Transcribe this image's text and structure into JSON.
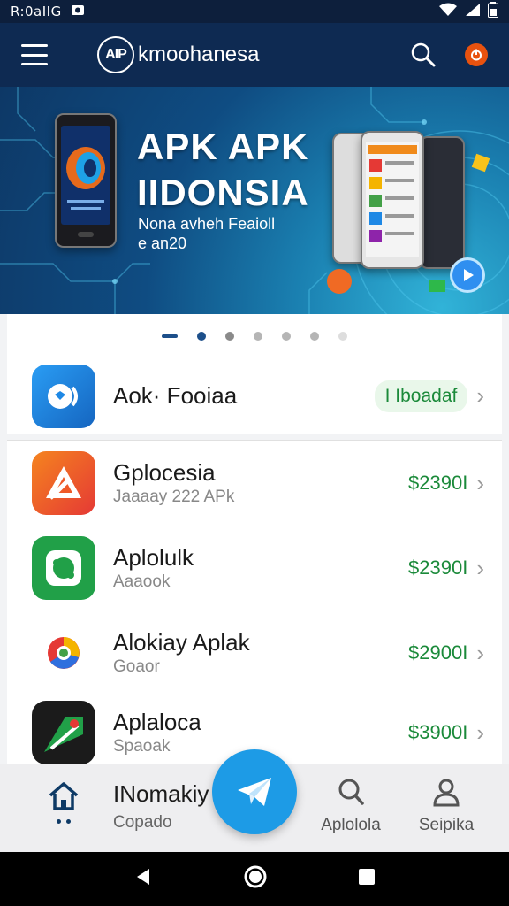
{
  "status_bar": {
    "time": "R:0aIIG"
  },
  "app_bar": {
    "logo_text": "AIP",
    "brand": "kmoohanesa"
  },
  "banner": {
    "title_line1": "APK APK",
    "title_line2": "IIDONSIA",
    "subtitle_line1": "Nona avheh Feaioll",
    "subtitle_line2": "e an20"
  },
  "carousel": {
    "slide_count": 7,
    "active_index": 1
  },
  "featured": {
    "title": "Aok· Fooiaa",
    "action": "I Iboadaf"
  },
  "apps": [
    {
      "name": "Gplocesia",
      "sub": "Jaaaay 222 APk",
      "price": "$2390I"
    },
    {
      "name": "Aplolulk",
      "sub": "Aaaook",
      "price": "$2390I"
    },
    {
      "name": "Alokiay Aplak",
      "sub": "Goaor",
      "price": "$2900I"
    },
    {
      "name": "Aplaloca",
      "sub": "Spaoak",
      "price": "$3900I"
    }
  ],
  "bottom_nav": {
    "home_title": "INomakiy",
    "home_sub": "Copado",
    "apps_label": "Aplolola",
    "profile_label": "Seipika"
  },
  "colors": {
    "header": "#0e2a52",
    "accent": "#1d9be6",
    "price": "#1b8a3a"
  }
}
